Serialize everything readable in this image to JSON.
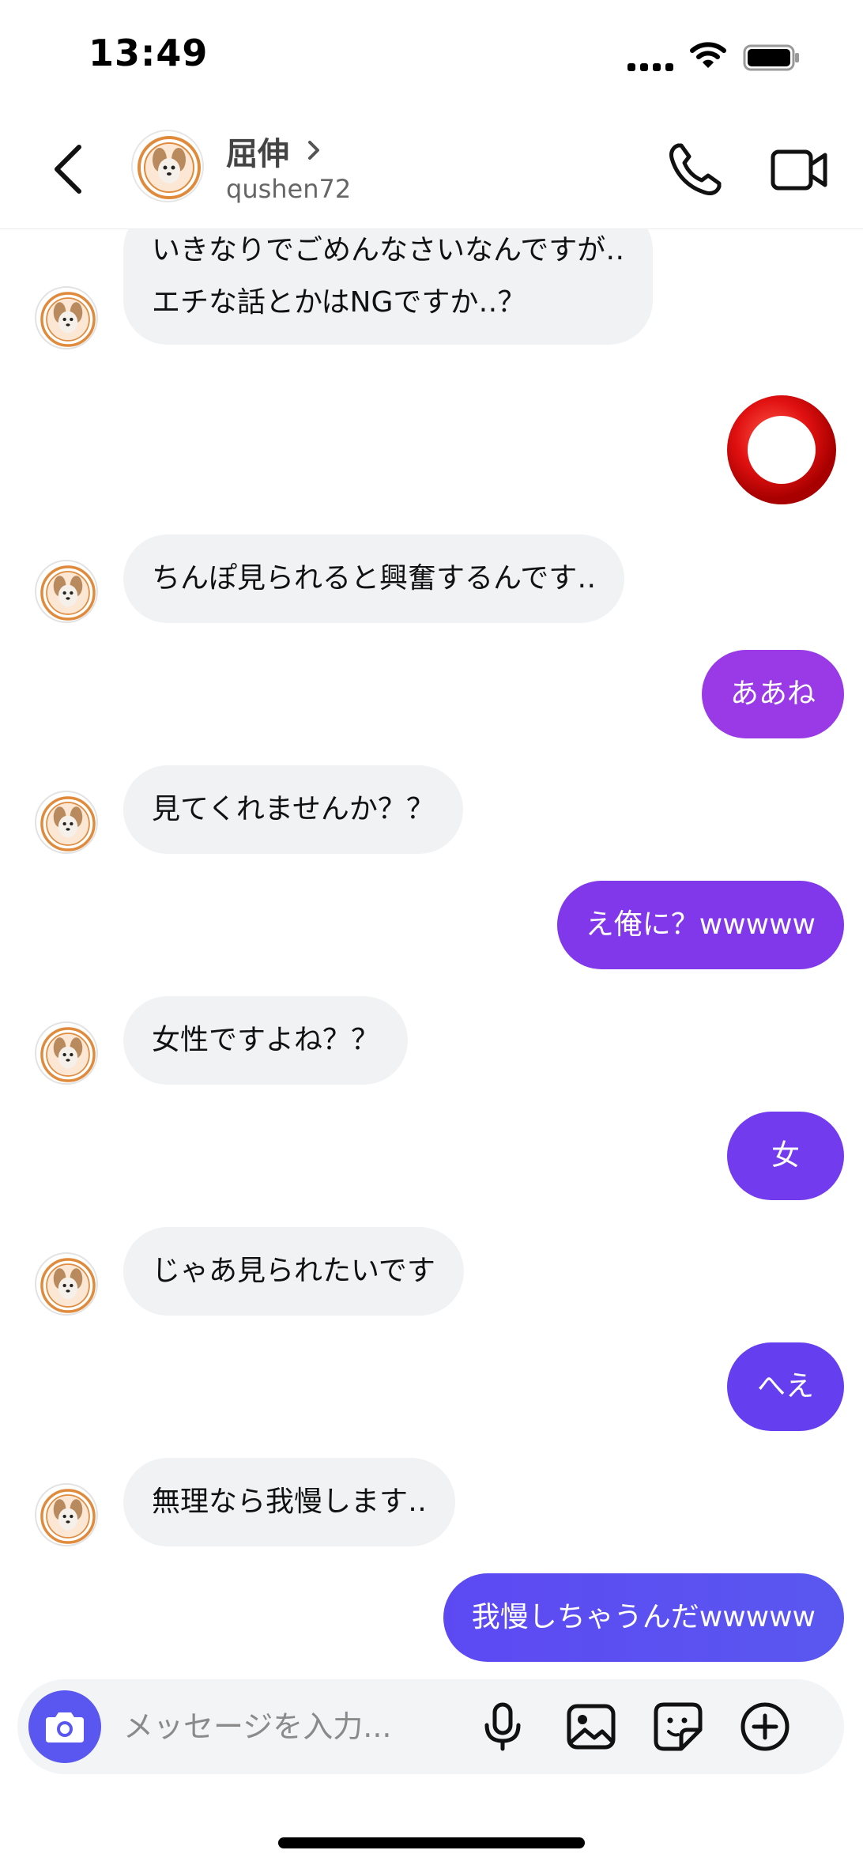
{
  "status_bar": {
    "time": "13:49"
  },
  "header": {
    "contact_name": "屈伸",
    "username": "qushen72"
  },
  "messages": [
    {
      "direction": "incoming",
      "lines": [
        "いきなりでごめんなさいなんですが‥",
        "エチな話とかはNGですか‥？"
      ]
    },
    {
      "direction": "outgoing",
      "type": "emoji",
      "emoji_name": "red-circle-emoji"
    },
    {
      "direction": "incoming",
      "text": "ちんぽ見られると興奮するんです‥"
    },
    {
      "direction": "outgoing",
      "text": "ああね"
    },
    {
      "direction": "incoming",
      "text": "見てくれませんか？？"
    },
    {
      "direction": "outgoing",
      "text": "え俺に？wwwww"
    },
    {
      "direction": "incoming",
      "text": "女性ですよね？？"
    },
    {
      "direction": "outgoing",
      "text": "女"
    },
    {
      "direction": "incoming",
      "text": "じゃあ見られたいです"
    },
    {
      "direction": "outgoing",
      "text": "へえ"
    },
    {
      "direction": "incoming",
      "text": "無理なら我慢します‥"
    },
    {
      "direction": "outgoing",
      "text": "我慢しちゃうんだwwwww"
    }
  ],
  "composer": {
    "placeholder": "メッセージを入力...",
    "icons": [
      "camera-icon",
      "microphone-icon",
      "image-icon",
      "sticker-icon",
      "plus-circle-icon"
    ]
  },
  "colors": {
    "incoming_bubble": "#f1f2f4",
    "outgoing_gradient_top": "#9f3de2",
    "outgoing_gradient_bottom": "#5a57f0",
    "camera_button": "#5a57f0"
  }
}
